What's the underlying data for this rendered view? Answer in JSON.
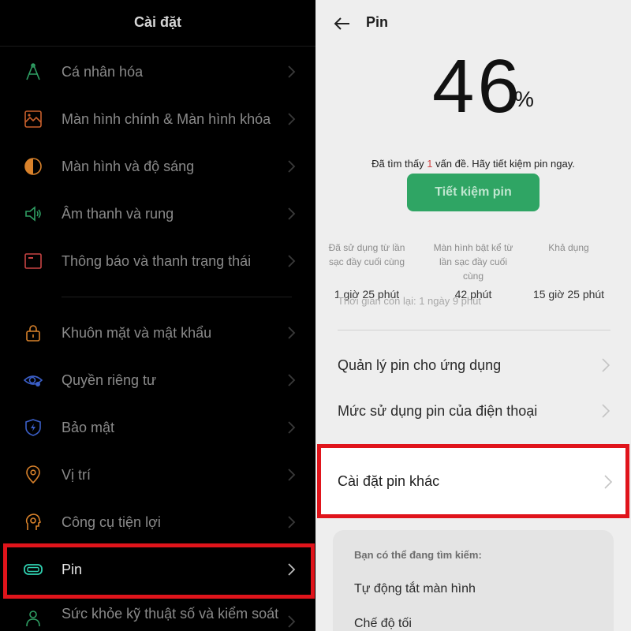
{
  "left": {
    "title": "Cài đặt",
    "items": [
      {
        "label": "Cá nhân hóa",
        "icon": "personalize-icon"
      },
      {
        "label": "Màn hình chính & Màn hình khóa",
        "icon": "home-screen-icon"
      },
      {
        "label": "Màn hình và độ sáng",
        "icon": "brightness-icon"
      },
      {
        "label": "Âm thanh và rung",
        "icon": "sound-icon"
      },
      {
        "label": "Thông báo và thanh trạng thái",
        "icon": "notification-icon"
      },
      {
        "label": "Khuôn mặt và mật khẩu",
        "icon": "lock-icon"
      },
      {
        "label": "Quyền riêng tư",
        "icon": "privacy-eye-icon"
      },
      {
        "label": "Bảo mật",
        "icon": "security-shield-icon"
      },
      {
        "label": "Vị trí",
        "icon": "location-pin-icon"
      },
      {
        "label": "Công cụ tiện lợi",
        "icon": "tools-icon"
      },
      {
        "label": "Pin",
        "icon": "battery-icon"
      },
      {
        "label": "Sức khỏe kỹ thuật số và kiểm soát",
        "icon": "wellbeing-icon"
      }
    ]
  },
  "right": {
    "title": "Pin",
    "percent": "46",
    "percent_sign": "%",
    "issue_prefix": "Đã tìm thấy ",
    "issue_count": "1",
    "issue_suffix": " vấn đề. Hãy tiết kiệm pin ngay.",
    "save_button": "Tiết kiệm pin",
    "stats": [
      {
        "caption": "Đã sử dụng từ lần sạc đầy cuối cùng",
        "value": "1 giờ 25 phút"
      },
      {
        "caption": "Màn hình bật kể từ lần sạc đầy cuối cùng",
        "value": "42 phút"
      },
      {
        "caption": "Khả dụng",
        "value": "15 giờ 25 phút"
      }
    ],
    "ghost_text": "Thời gian còn lại:  1 ngày 9 phút",
    "menu": [
      {
        "label": "Quản lý pin cho ứng dụng"
      },
      {
        "label": "Mức sử dụng pin của điện thoại"
      }
    ],
    "other_settings": "Cài đặt pin khác",
    "search": {
      "heading": "Bạn có thể đang tìm kiếm:",
      "items": [
        "Tự động tắt màn hình",
        "Chế độ tối"
      ]
    }
  },
  "colors": {
    "highlight_red": "#e0141b",
    "save_green": "#2fa564",
    "issue_red": "#d04545"
  }
}
